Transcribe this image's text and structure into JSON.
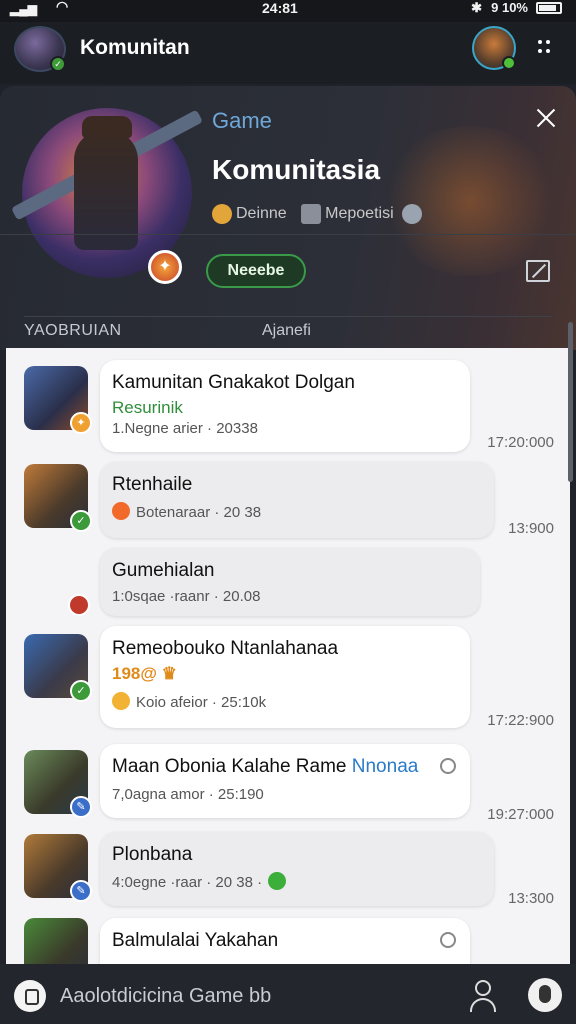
{
  "status_bar": {
    "time": "24:81",
    "battery": "9 10%"
  },
  "app_bar": {
    "title": "Komunitan"
  },
  "header": {
    "category": "Game",
    "name": "Komunitasia",
    "meta_one": "Deinne",
    "meta_two": "Mepoetisi",
    "pill_label": "Neeebe",
    "tab_left": "YAOBRUIAN",
    "tab_right": "Ajanefi"
  },
  "messages": [
    {
      "title": "Kamunitan Gnakakot Dolgan",
      "subtitle": "Resurinik",
      "subtitle_color": "#2f8f3a",
      "meta": "1.Negne arier · 20338",
      "time": "17:20:000",
      "badge_color": "#f0a030"
    },
    {
      "title": "Rtenhaile",
      "meta": "Botenaraar · 20 38",
      "time": "13:900",
      "badge_color": "#3c9a3a"
    },
    {
      "title": "Gumehialan",
      "meta": "1:0sqae ·raanr · 20.08"
    },
    {
      "title": "Remeobouko Ntanlahanaa",
      "subtitle": "198@ ♛",
      "subtitle_color": "#e08a1a",
      "meta": "Koio afeior · 25:10k",
      "time": "17:22:900",
      "badge_color": "#3c9a3a"
    },
    {
      "title": "Maan Obonia Kalahe Rame",
      "title_accent": "Nnonaa",
      "meta": "7,0agna amor · 25:190",
      "time": "19:27:000",
      "badge_color": "#3a6ec9"
    },
    {
      "title": "Plonbana",
      "meta": "4:0egne ·raar · 20 38 ·",
      "time": "13:300",
      "badge_color": "#3a6ec9"
    },
    {
      "title": "Balmulalai Yakahan",
      "meta": ""
    }
  ],
  "composer": {
    "placeholder": "Aaolotdicicina Game bb"
  }
}
